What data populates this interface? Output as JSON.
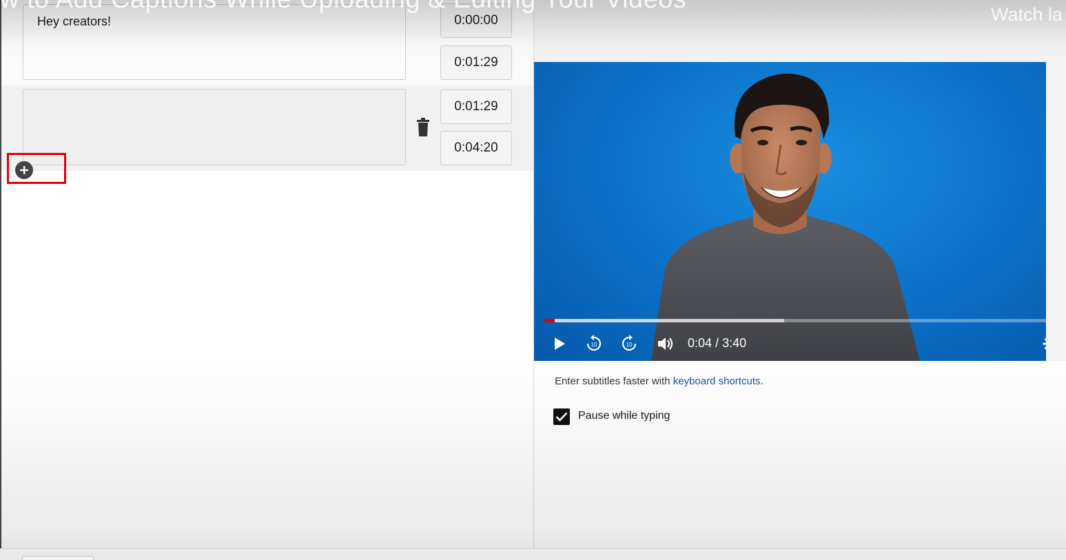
{
  "overlay": {
    "title_text": "w to Add Captions While Uploading & Editing Your Videos",
    "watch_later": "Watch la"
  },
  "editor": {
    "cues": [
      {
        "text": "Hey creators!",
        "start": "0:00:00",
        "end": "0:01:29"
      },
      {
        "text": "",
        "start": "0:01:29",
        "end": "0:04:20"
      }
    ]
  },
  "player": {
    "time_current": "0:04",
    "time_separator": " / ",
    "time_total": "3:40",
    "progress_played_fraction": 0.02,
    "progress_buffered_fraction": 0.47
  },
  "hint": {
    "prefix": "Enter subtitles faster with ",
    "link": "keyboard shortcuts",
    "suffix": "."
  },
  "options": {
    "pause_while_typing_label": "Pause while typing",
    "pause_while_typing_checked": true
  },
  "colors": {
    "highlight": "#e00000",
    "progress": "#e00000",
    "link": "#1a4fa8",
    "video_bg": "#0a70c8"
  },
  "icons": [
    "trash-icon",
    "add-circle-icon",
    "play-icon",
    "rewind-10-icon",
    "forward-10-icon",
    "volume-icon",
    "gear-icon",
    "check-icon"
  ]
}
